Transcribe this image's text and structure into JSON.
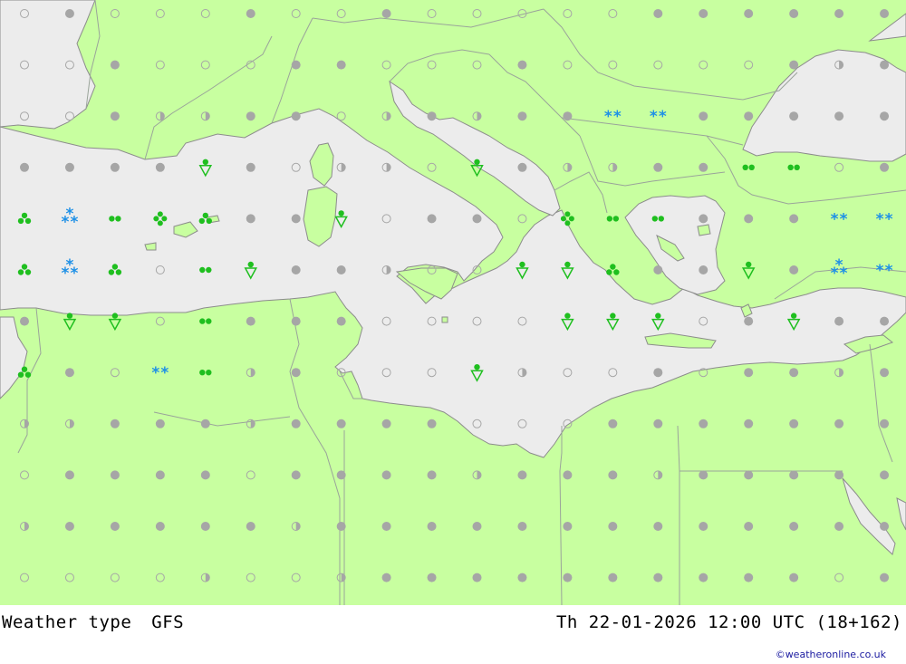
{
  "title": "Weather type",
  "model": "GFS",
  "valid_time": "Th 22-01-2026 12:00 UTC (18+162)",
  "credit": "©weatheronline.co.uk",
  "colors": {
    "land": "#c8ffa0",
    "sea": "#ececec",
    "border": "#9aa49a",
    "coast": "#8c8c8c",
    "cloud_dot": "#a6a6a6",
    "rain": "#1fbf1f",
    "snow": "#1e90e6"
  },
  "symbol_legend": {
    "clear": "open circle",
    "partly": "half-filled circle",
    "overcast": "filled grey circle",
    "rain": "green dots",
    "shower": "green triangle",
    "snow": "blue asterisks"
  },
  "symbol_grid": [
    [
      "clear",
      "overcast",
      "clear",
      "clear",
      "clear",
      "overcast",
      "clear",
      "clear",
      "overcast",
      "clear",
      "clear",
      "clear",
      "clear",
      "clear",
      "overcast",
      "overcast",
      "overcast",
      "overcast",
      "overcast",
      "overcast"
    ],
    [
      "clear",
      "clear",
      "overcast",
      "clear",
      "clear",
      "clear",
      "overcast",
      "overcast",
      "clear",
      "clear",
      "clear",
      "overcast",
      "clear",
      "clear",
      "clear",
      "clear",
      "clear",
      "overcast",
      "partly",
      "overcast"
    ],
    [
      "clear",
      "clear",
      "overcast",
      "partly",
      "partly",
      "overcast",
      "overcast",
      "clear",
      "partly",
      "overcast",
      "partly",
      "overcast",
      "overcast",
      "snow2",
      "snow2",
      "overcast",
      "overcast",
      "overcast",
      "overcast",
      "overcast"
    ],
    [
      "overcast",
      "overcast",
      "overcast",
      "overcast",
      "shower",
      "overcast",
      "clear",
      "partly",
      "partly",
      "clear",
      "shower",
      "overcast",
      "partly",
      "partly",
      "overcast",
      "overcast",
      "rain2",
      "rain2",
      "clear",
      "overcast"
    ],
    [
      "rain3",
      "snow3",
      "rain2",
      "rain4",
      "rain3",
      "overcast",
      "overcast",
      "shower",
      "clear",
      "overcast",
      "overcast",
      "clear",
      "rain4",
      "rain2",
      "rain2",
      "overcast",
      "overcast",
      "overcast",
      "snow2",
      "snow2"
    ],
    [
      "rain3",
      "snow3",
      "rain3",
      "clear",
      "rain2",
      "shower",
      "overcast",
      "overcast",
      "partly",
      "clear",
      "clear",
      "shower",
      "shower",
      "rain3",
      "overcast",
      "overcast",
      "shower",
      "overcast",
      "snow3",
      "snow2"
    ],
    [
      "overcast",
      "shower",
      "shower",
      "clear",
      "rain2",
      "overcast",
      "overcast",
      "overcast",
      "clear",
      "clear",
      "clear",
      "clear",
      "shower",
      "shower",
      "shower",
      "clear",
      "overcast",
      "shower",
      "overcast",
      "overcast"
    ],
    [
      "rain3",
      "overcast",
      "clear",
      "snow2",
      "rain2",
      "partly",
      "overcast",
      "clear",
      "clear",
      "clear",
      "shower",
      "partly",
      "clear",
      "clear",
      "overcast",
      "clear",
      "overcast",
      "overcast",
      "partly",
      "overcast"
    ],
    [
      "partly",
      "partly",
      "overcast",
      "overcast",
      "overcast",
      "partly",
      "overcast",
      "overcast",
      "overcast",
      "overcast",
      "clear",
      "clear",
      "clear",
      "overcast",
      "overcast",
      "overcast",
      "overcast",
      "overcast",
      "overcast",
      "overcast"
    ],
    [
      "clear",
      "overcast",
      "overcast",
      "overcast",
      "overcast",
      "clear",
      "overcast",
      "overcast",
      "overcast",
      "overcast",
      "partly",
      "overcast",
      "overcast",
      "overcast",
      "partly",
      "overcast",
      "overcast",
      "overcast",
      "overcast",
      "overcast"
    ],
    [
      "partly",
      "overcast",
      "overcast",
      "overcast",
      "overcast",
      "overcast",
      "partly",
      "overcast",
      "overcast",
      "overcast",
      "overcast",
      "overcast",
      "overcast",
      "overcast",
      "overcast",
      "overcast",
      "overcast",
      "overcast",
      "overcast",
      "overcast"
    ],
    [
      "clear",
      "clear",
      "clear",
      "clear",
      "partly",
      "clear",
      "clear",
      "partly",
      "overcast",
      "overcast",
      "overcast",
      "overcast",
      "overcast",
      "overcast",
      "overcast",
      "overcast",
      "overcast",
      "overcast",
      "clear",
      "overcast"
    ]
  ]
}
